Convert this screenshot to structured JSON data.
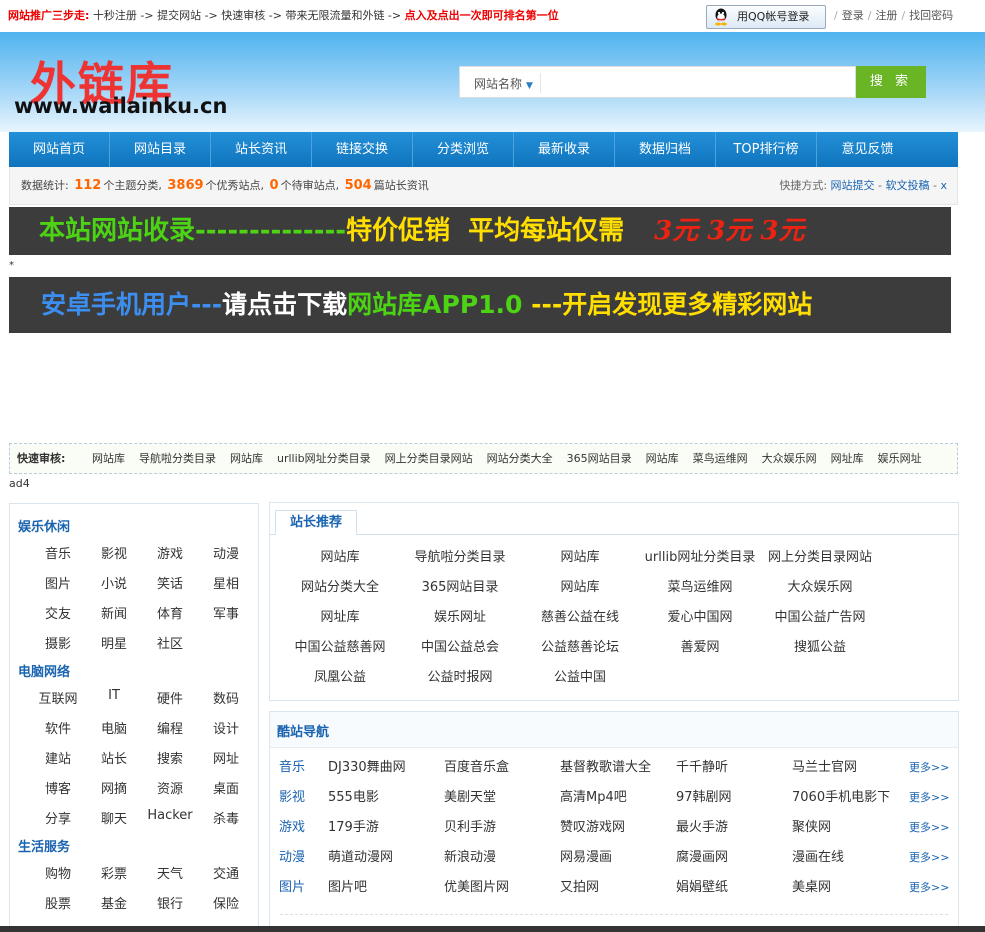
{
  "topbar": {
    "steps_label": "网站推广三步走:",
    "steps_text": " 十秒注册 -> 提交网站 -> 快速审核 -> 带来无限流量和外链 -> ",
    "steps_highlight": "点入及点出一次即可排名第一位",
    "qq_login": "用QQ帐号登录",
    "links": [
      "登录",
      "注册",
      "找回密码"
    ]
  },
  "header": {
    "logo_text": "外链库",
    "logo_url": "www.wailainku.cn",
    "search_select": "网站名称",
    "search_placeholder": "",
    "search_button": "搜 索"
  },
  "nav": [
    "网站首页",
    "网站目录",
    "站长资讯",
    "链接交换",
    "分类浏览",
    "最新收录",
    "数据归档",
    "TOP排行榜",
    "意见反馈"
  ],
  "stats": {
    "prefix": "数据统计:",
    "categories": "112",
    "categories_label": "个主题分类,",
    "sites": "3869",
    "sites_label": "个优秀站点,",
    "pending": "0",
    "pending_label": "个待审站点,",
    "articles": "504",
    "articles_label": "篇站长资讯",
    "shortcut_label": "快捷方式:",
    "shortcut_1": "网站提交",
    "shortcut_2": "软文投稿",
    "shortcut_x": "x"
  },
  "banner1": {
    "a": "本站网站收录",
    "b": "--------------",
    "c": "特价促销",
    "d": "平均每站仅需",
    "e": "3元  3元  3元"
  },
  "star": "*",
  "banner2": {
    "a": "安卓手机用户---",
    "b": "请点击下载",
    "c": "网站库APP1.0",
    "d": " ---开启发现更多精彩网站"
  },
  "quick": {
    "label": "快速审核:",
    "links": [
      "网站库",
      "导航啦分类目录",
      "网站库",
      "urllib网址分类目录",
      "网上分类目录网站",
      "网站分类大全",
      "365网站目录",
      "网站库",
      "菜鸟运维网",
      "大众娱乐网",
      "网址库",
      "娱乐网址"
    ]
  },
  "ad4": "ad4",
  "sidebar": {
    "groups": [
      {
        "title": "娱乐休闲",
        "rows": [
          [
            "音乐",
            "影视",
            "游戏",
            "动漫"
          ],
          [
            "图片",
            "小说",
            "笑话",
            "星相"
          ],
          [
            "交友",
            "新闻",
            "体育",
            "军事"
          ],
          [
            "摄影",
            "明星",
            "社区"
          ]
        ]
      },
      {
        "title": "电脑网络",
        "rows": [
          [
            "互联网",
            "IT",
            "硬件",
            "数码"
          ],
          [
            "软件",
            "电脑",
            "编程",
            "设计"
          ],
          [
            "建站",
            "站长",
            "搜索",
            "网址"
          ],
          [
            "博客",
            "网摘",
            "资源",
            "桌面"
          ],
          [
            "分享",
            "聊天",
            "Hacker",
            "杀毒"
          ]
        ]
      },
      {
        "title": "生活服务",
        "rows": [
          [
            "购物",
            "彩票",
            "天气",
            "交通"
          ],
          [
            "股票",
            "基金",
            "银行",
            "保险"
          ]
        ]
      }
    ]
  },
  "recommend": {
    "tab": "站长推荐",
    "rows": [
      [
        "网站库",
        "导航啦分类目录",
        "网站库",
        "urllib网址分类目录",
        "网上分类目录网站"
      ],
      [
        "网站分类大全",
        "365网站目录",
        "网站库",
        "菜鸟运维网",
        "大众娱乐网"
      ],
      [
        "网址库",
        "娱乐网址",
        "慈善公益在线",
        "爱心中国网",
        "中国公益广告网"
      ],
      [
        "中国公益慈善网",
        "中国公益总会",
        "公益慈善论坛",
        "善爱网",
        "搜狐公益"
      ],
      [
        "凤凰公益",
        "公益时报网",
        "公益中国"
      ]
    ]
  },
  "coolnav": {
    "title": "酷站导航",
    "more": "更多>>",
    "rows": [
      {
        "cat": "音乐",
        "links": [
          "DJ330舞曲网",
          "百度音乐盒",
          "基督教歌谱大全",
          "千千静听",
          "马兰士官网"
        ]
      },
      {
        "cat": "影视",
        "links": [
          "555电影",
          "美剧天堂",
          "高清Mp4吧",
          "97韩剧网",
          "7060手机电影下"
        ]
      },
      {
        "cat": "游戏",
        "links": [
          "179手游",
          "贝利手游",
          "赞叹游戏网",
          "最火手游",
          "聚侠网"
        ]
      },
      {
        "cat": "动漫",
        "links": [
          "萌道动漫网",
          "新浪动漫",
          "网易漫画",
          "腐漫画网",
          "漫画在线"
        ]
      },
      {
        "cat": "图片",
        "links": [
          "图片吧",
          "优美图片网",
          "又拍网",
          "娟娟壁纸",
          "美桌网"
        ]
      }
    ]
  }
}
